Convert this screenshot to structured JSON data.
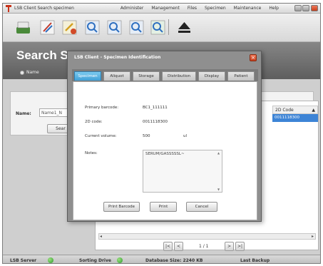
{
  "app": {
    "title": "LSB Client  Search specimen",
    "menu": [
      "Administer",
      "Management",
      "Files",
      "Specimen",
      "Maintenance",
      "Help"
    ]
  },
  "page": {
    "title": "Search S",
    "name_option": "Name"
  },
  "search": {
    "label": "Name:",
    "input_value": "Name1_N",
    "button_label": "Sear"
  },
  "results": {
    "column_header": "2D Code",
    "selected_row": "0011118300"
  },
  "pager": {
    "first": "|<",
    "prev": "<",
    "page_indicator": "1 / 1",
    "next": ">",
    "last": ">|"
  },
  "status": {
    "lsb_server": "LSB Server",
    "sorting_drive": "Sorting Drive",
    "database_size": "Database Size:  2240 KB",
    "last_backup": "Last Backup"
  },
  "dialog": {
    "title": "LSB Client - Specimen Identification",
    "close": "×",
    "tabs": [
      "Specimen",
      "Aliquot",
      "Storage",
      "Distribution",
      "Display",
      "Patient"
    ],
    "active_tab": 0,
    "fields": {
      "primary_barcode_label": "Primary barcode:",
      "primary_barcode_value": "BC1_111111",
      "code2d_label": "2D code:",
      "code2d_value": "0011118300",
      "volume_label": "Current volume:",
      "volume_value": "500",
      "volume_unit": "ul",
      "notes_label": "Notes:",
      "notes_value": "SERUM/GASSSSSL~"
    },
    "buttons": {
      "print_barcode": "Print Barcode",
      "print": "Print",
      "cancel": "Cancel"
    }
  },
  "colors": {
    "accent": "#3d84d6",
    "active_tab": "#3f9fd6",
    "close_red": "#d24a28",
    "status_ok": "#3aa83a"
  }
}
